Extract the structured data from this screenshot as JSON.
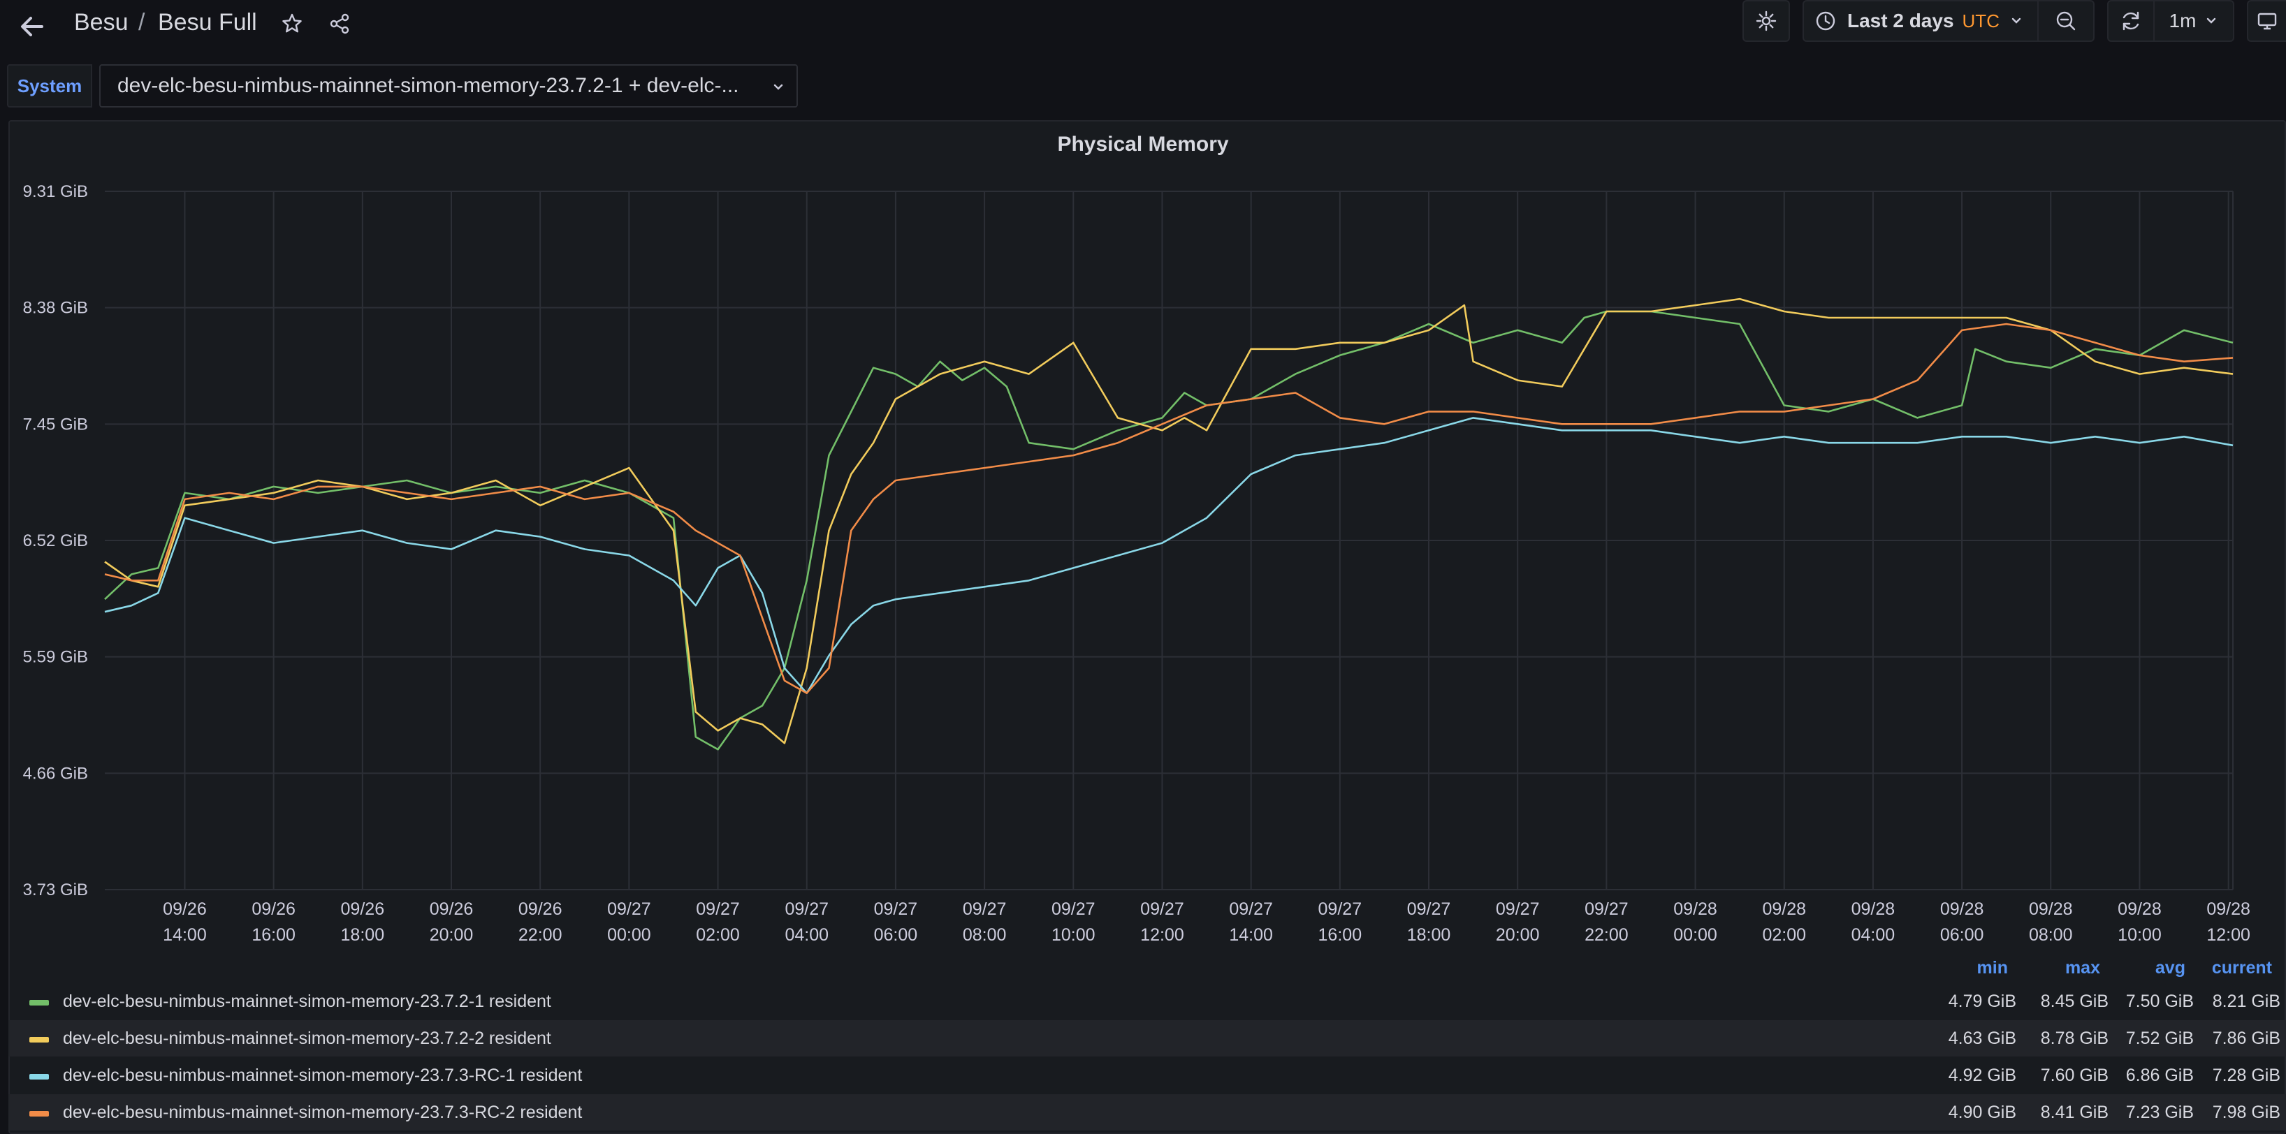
{
  "header": {
    "breadcrumb_parent": "Besu",
    "breadcrumb_current": "Besu Full",
    "breadcrumb_separator": "/",
    "time_range": "Last 2 days",
    "timezone": "UTC",
    "refresh_interval": "1m"
  },
  "variables": {
    "label": "System",
    "value": "dev-elc-besu-nimbus-mainnet-simon-memory-23.7.2-1 + dev-elc-..."
  },
  "panel": {
    "title": "Physical Memory"
  },
  "legend": {
    "headers": {
      "min": "min",
      "max": "max",
      "avg": "avg",
      "current": "current"
    },
    "rows": [
      {
        "name": "dev-elc-besu-nimbus-mainnet-simon-memory-23.7.2-1 resident",
        "color": "#73bf69",
        "min": "4.79 GiB",
        "max": "8.45 GiB",
        "avg": "7.50 GiB",
        "current": "8.21 GiB"
      },
      {
        "name": "dev-elc-besu-nimbus-mainnet-simon-memory-23.7.2-2 resident",
        "color": "#f2cc5c",
        "min": "4.63 GiB",
        "max": "8.78 GiB",
        "avg": "7.52 GiB",
        "current": "7.86 GiB"
      },
      {
        "name": "dev-elc-besu-nimbus-mainnet-simon-memory-23.7.3-RC-1 resident",
        "color": "#8ad8e8",
        "min": "4.92 GiB",
        "max": "7.60 GiB",
        "avg": "6.86 GiB",
        "current": "7.28 GiB"
      },
      {
        "name": "dev-elc-besu-nimbus-mainnet-simon-memory-23.7.3-RC-2 resident",
        "color": "#f28c48",
        "min": "4.90 GiB",
        "max": "8.41 GiB",
        "avg": "7.23 GiB",
        "current": "7.98 GiB"
      }
    ]
  },
  "chart_data": {
    "type": "line",
    "title": "Physical Memory",
    "y_unit": "GiB",
    "ylim": [
      3.73,
      9.31
    ],
    "y_ticks": [
      "9.31 GiB",
      "8.38 GiB",
      "7.45 GiB",
      "6.52 GiB",
      "5.59 GiB",
      "4.66 GiB",
      "3.73 GiB"
    ],
    "x_ticks": [
      [
        "09/26",
        "14:00"
      ],
      [
        "09/26",
        "16:00"
      ],
      [
        "09/26",
        "18:00"
      ],
      [
        "09/26",
        "20:00"
      ],
      [
        "09/26",
        "22:00"
      ],
      [
        "09/27",
        "00:00"
      ],
      [
        "09/27",
        "02:00"
      ],
      [
        "09/27",
        "04:00"
      ],
      [
        "09/27",
        "06:00"
      ],
      [
        "09/27",
        "08:00"
      ],
      [
        "09/27",
        "10:00"
      ],
      [
        "09/27",
        "12:00"
      ],
      [
        "09/27",
        "14:00"
      ],
      [
        "09/27",
        "16:00"
      ],
      [
        "09/27",
        "18:00"
      ],
      [
        "09/27",
        "20:00"
      ],
      [
        "09/27",
        "22:00"
      ],
      [
        "09/28",
        "00:00"
      ],
      [
        "09/28",
        "02:00"
      ],
      [
        "09/28",
        "04:00"
      ],
      [
        "09/28",
        "06:00"
      ],
      [
        "09/28",
        "08:00"
      ],
      [
        "09/28",
        "10:00"
      ],
      [
        "09/28",
        "12:00"
      ]
    ],
    "x_unit": "hours from 09/26 14:00",
    "x_range": [
      -1.8,
      46.1
    ],
    "grid": true,
    "series": [
      {
        "name": "dev-elc-besu-nimbus-mainnet-simon-memory-23.7.2-1 resident",
        "color": "#73bf69",
        "x": [
          -1.8,
          -1.2,
          -0.6,
          0,
          1,
          2,
          3,
          4,
          5,
          6,
          7,
          8,
          9,
          10,
          11,
          11.5,
          12,
          12.5,
          13,
          13.5,
          14,
          14.5,
          15,
          15.5,
          16,
          16.5,
          17,
          17.5,
          18,
          18.5,
          19,
          20,
          21,
          22,
          22.5,
          23,
          24,
          25,
          26,
          27,
          28,
          29,
          30,
          31,
          31.5,
          32,
          33,
          34,
          35,
          36,
          37,
          38,
          39,
          40,
          40.3,
          41,
          42,
          43,
          44,
          45,
          46.1
        ],
        "y": [
          6.05,
          6.25,
          6.3,
          6.9,
          6.85,
          6.95,
          6.9,
          6.95,
          7.0,
          6.9,
          6.95,
          6.9,
          7.0,
          6.9,
          6.7,
          4.95,
          4.85,
          5.1,
          5.2,
          5.5,
          6.2,
          7.2,
          7.55,
          7.9,
          7.85,
          7.75,
          7.95,
          7.8,
          7.9,
          7.75,
          7.3,
          7.25,
          7.4,
          7.5,
          7.7,
          7.6,
          7.65,
          7.85,
          8.0,
          8.1,
          8.25,
          8.1,
          8.2,
          8.1,
          8.3,
          8.35,
          8.35,
          8.3,
          8.25,
          7.6,
          7.55,
          7.65,
          7.5,
          7.6,
          8.05,
          7.95,
          7.9,
          8.05,
          8.0,
          8.2,
          8.1
        ]
      },
      {
        "name": "dev-elc-besu-nimbus-mainnet-simon-memory-23.7.2-2 resident",
        "color": "#f2cc5c",
        "x": [
          -1.8,
          -1.2,
          -0.6,
          0,
          1,
          2,
          3,
          4,
          5,
          6,
          7,
          8,
          9,
          10,
          11,
          11.5,
          12,
          12.5,
          13,
          13.5,
          14,
          14.5,
          15,
          15.5,
          16,
          16.5,
          17,
          18,
          19,
          20,
          21,
          22,
          22.5,
          23,
          24,
          25,
          26,
          27,
          28,
          28.8,
          29,
          30,
          31,
          32,
          33,
          34,
          35,
          36,
          37,
          38,
          39,
          40,
          41,
          42,
          43,
          44,
          45,
          46.1
        ],
        "y": [
          6.35,
          6.2,
          6.15,
          6.8,
          6.85,
          6.9,
          7.0,
          6.95,
          6.85,
          6.9,
          7.0,
          6.8,
          6.95,
          7.1,
          6.6,
          5.15,
          5.0,
          5.1,
          5.05,
          4.9,
          5.5,
          6.6,
          7.05,
          7.3,
          7.65,
          7.75,
          7.85,
          7.95,
          7.85,
          8.1,
          7.5,
          7.4,
          7.5,
          7.4,
          8.05,
          8.05,
          8.1,
          8.1,
          8.2,
          8.4,
          7.95,
          7.8,
          7.75,
          8.35,
          8.35,
          8.4,
          8.45,
          8.35,
          8.3,
          8.3,
          8.3,
          8.3,
          8.3,
          8.2,
          7.95,
          7.85,
          7.9,
          7.85
        ]
      },
      {
        "name": "dev-elc-besu-nimbus-mainnet-simon-memory-23.7.3-RC-1 resident",
        "color": "#8ad8e8",
        "x": [
          -1.8,
          -1.2,
          -0.6,
          0,
          1,
          2,
          3,
          4,
          5,
          6,
          7,
          8,
          9,
          10,
          11,
          11.5,
          12,
          12.5,
          13,
          13.5,
          14,
          14.5,
          15,
          15.5,
          16,
          17,
          18,
          19,
          20,
          21,
          22,
          23,
          24,
          25,
          26,
          27,
          28,
          29,
          30,
          31,
          32,
          33,
          34,
          35,
          36,
          37,
          38,
          39,
          40,
          41,
          42,
          43,
          44,
          45,
          46.1
        ],
        "y": [
          5.95,
          6.0,
          6.1,
          6.7,
          6.6,
          6.5,
          6.55,
          6.6,
          6.5,
          6.45,
          6.6,
          6.55,
          6.45,
          6.4,
          6.2,
          6.0,
          6.3,
          6.4,
          6.1,
          5.5,
          5.3,
          5.6,
          5.85,
          6.0,
          6.05,
          6.1,
          6.15,
          6.2,
          6.3,
          6.4,
          6.5,
          6.7,
          7.05,
          7.2,
          7.25,
          7.3,
          7.4,
          7.5,
          7.45,
          7.4,
          7.4,
          7.4,
          7.35,
          7.3,
          7.35,
          7.3,
          7.3,
          7.3,
          7.35,
          7.35,
          7.3,
          7.35,
          7.3,
          7.35,
          7.28
        ]
      },
      {
        "name": "dev-elc-besu-nimbus-mainnet-simon-memory-23.7.3-RC-2 resident",
        "color": "#f28c48",
        "x": [
          -1.8,
          -1.2,
          -0.6,
          0,
          1,
          2,
          3,
          4,
          5,
          6,
          7,
          8,
          9,
          10,
          11,
          11.5,
          12,
          12.5,
          13,
          13.5,
          14,
          14.5,
          15,
          15.5,
          16,
          17,
          18,
          19,
          20,
          21,
          22,
          23,
          24,
          25,
          26,
          27,
          28,
          29,
          30,
          31,
          32,
          33,
          34,
          35,
          36,
          37,
          38,
          39,
          40,
          41,
          42,
          43,
          44,
          45,
          46.1
        ],
        "y": [
          6.25,
          6.2,
          6.2,
          6.85,
          6.9,
          6.85,
          6.95,
          6.95,
          6.9,
          6.85,
          6.9,
          6.95,
          6.85,
          6.9,
          6.75,
          6.6,
          6.5,
          6.4,
          5.9,
          5.4,
          5.3,
          5.5,
          6.6,
          6.85,
          7.0,
          7.05,
          7.1,
          7.15,
          7.2,
          7.3,
          7.45,
          7.6,
          7.65,
          7.7,
          7.5,
          7.45,
          7.55,
          7.55,
          7.5,
          7.45,
          7.45,
          7.45,
          7.5,
          7.55,
          7.55,
          7.6,
          7.65,
          7.8,
          8.2,
          8.25,
          8.2,
          8.1,
          8.0,
          7.95,
          7.98
        ]
      }
    ]
  }
}
